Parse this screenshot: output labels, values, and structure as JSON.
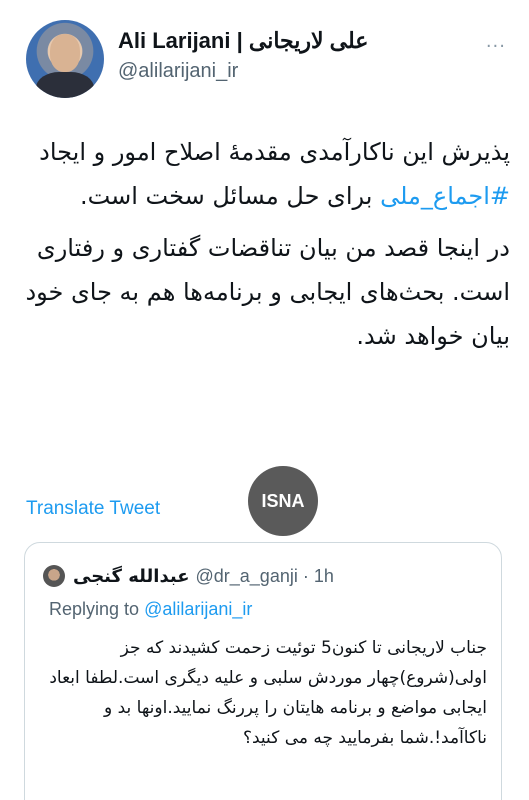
{
  "author": {
    "display_name": "Ali Larijani | علی لاریجانی",
    "handle": "@alilarijani_ir",
    "more_glyph": "···"
  },
  "tweet": {
    "paragraph1_before": "پذیرش این ناکارآمدی مقدمهٔ اصلاح امور و ایجاد ",
    "hashtag": "#اجماع_ملی",
    "paragraph1_after": " برای حل مسائل سخت است.",
    "paragraph2": "در اینجا قصد من بیان تناقضات گفتاری و رفتاری است. بحث‌های ایجابی و برنامه‌ها هم به جای خود بیان خواهد شد."
  },
  "translate_label": "Translate Tweet",
  "watermark": "ISNA",
  "quoted": {
    "name": "عبدالله گنجی",
    "handle_time": "@dr_a_ganji · 1h",
    "replying_prefix": "Replying to ",
    "replying_handle": "@alilarijani_ir",
    "text": "جناب لاریجانی تا کنون5 توئیت زحمت کشیدند که جز اولی(شروع)چهار موردش سلبی و علیه دیگری است.لطفا ابعاد ایجابی مواضع و برنامه هایتان را پررنگ نمایید.اونها بد و ناکاآمد!.شما بفرمایید چه می کنید؟"
  },
  "colors": {
    "link": "#1d9bf0",
    "secondary": "#536471",
    "text": "#0f1419"
  }
}
